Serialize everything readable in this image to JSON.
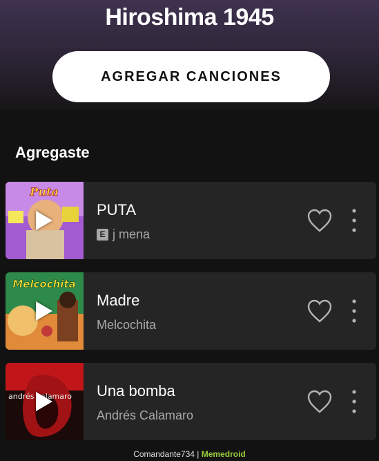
{
  "playlist": {
    "title": "Hiroshima 1945",
    "add_button_label": "AGREGAR CANCIONES"
  },
  "section": {
    "title": "Agregaste"
  },
  "songs": [
    {
      "title": "PUTA",
      "artist": "j mena",
      "explicit": true,
      "explicit_label": "E",
      "cover_text": "Puta"
    },
    {
      "title": "Madre",
      "artist": "Melcochita",
      "explicit": false,
      "cover_text": "Melcochita"
    },
    {
      "title": "Una bomba",
      "artist": "Andrés Calamaro",
      "explicit": false,
      "cover_text": "andrés calamaro"
    }
  ],
  "icons": {
    "like": "heart-outline-icon",
    "more": "vertical-dots-icon",
    "play": "play-icon"
  },
  "watermark": {
    "user": "Comandante734 |",
    "brand": "Memedroid"
  },
  "colors": {
    "background": "#121212",
    "row": "#252525",
    "secondary_text": "#a8a8a8",
    "brand_green": "#9ccc3c"
  }
}
